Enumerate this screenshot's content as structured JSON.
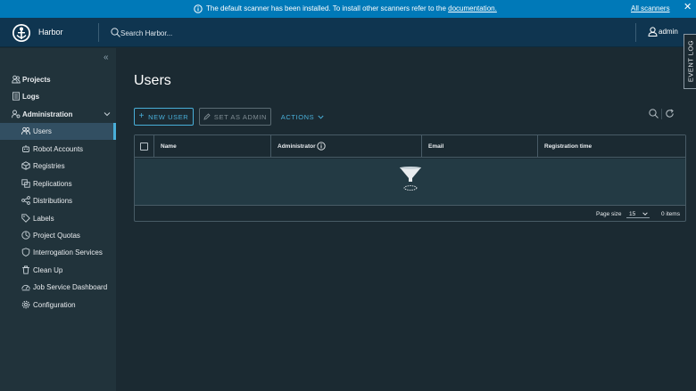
{
  "banner": {
    "message": "The default scanner has been installed. To install other scanners refer to the ",
    "link": "documentation.",
    "all_scanners": "All scanners",
    "close": "✕"
  },
  "header": {
    "brand": "Harbor",
    "search_placeholder": "Search Harbor...",
    "user": "admin",
    "event_log": "EVENT LOG"
  },
  "sidebar": {
    "collapse": "«",
    "items": [
      {
        "label": "Projects",
        "icon": "projects-icon"
      },
      {
        "label": "Logs",
        "icon": "logs-icon"
      },
      {
        "label": "Administration",
        "icon": "administration-icon"
      }
    ],
    "admin_items": [
      {
        "label": "Users",
        "icon": "users-icon",
        "active": true
      },
      {
        "label": "Robot Accounts",
        "icon": "robot-icon"
      },
      {
        "label": "Registries",
        "icon": "registries-icon"
      },
      {
        "label": "Replications",
        "icon": "replications-icon"
      },
      {
        "label": "Distributions",
        "icon": "distributions-icon"
      },
      {
        "label": "Labels",
        "icon": "labels-icon"
      },
      {
        "label": "Project Quotas",
        "icon": "quotas-icon"
      },
      {
        "label": "Interrogation Services",
        "icon": "shield-icon"
      },
      {
        "label": "Clean Up",
        "icon": "trash-icon"
      },
      {
        "label": "Job Service Dashboard",
        "icon": "dashboard-icon"
      },
      {
        "label": "Configuration",
        "icon": "gear-icon"
      }
    ]
  },
  "main": {
    "title": "Users",
    "buttons": {
      "new_user": "New User",
      "set_as_admin": "Set as Admin",
      "actions": "Actions"
    },
    "grid": {
      "columns": [
        "Name",
        "Administrator",
        "Email",
        "Registration time"
      ],
      "page_size_label": "Page size",
      "page_size": "15",
      "items": "0 items"
    }
  },
  "colors": {
    "banner": "#0079b8",
    "header": "#0f3550",
    "accent": "#49afd9",
    "background": "#1b2a32",
    "sidebar": "#21333b"
  }
}
